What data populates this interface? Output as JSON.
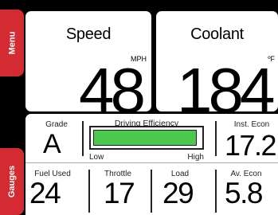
{
  "gauges": {
    "speed": {
      "label": "Speed",
      "unit": "MPH",
      "value": "48"
    },
    "coolant": {
      "label": "Coolant",
      "unit": "ºF",
      "value": "184"
    }
  },
  "tabs": {
    "menu": "Menu",
    "gauges": "Gauges"
  },
  "grade": {
    "label": "Grade",
    "value": "A"
  },
  "efficiency": {
    "label": "Driving Efficiency",
    "low": "Low",
    "high": "High",
    "level": 0.97,
    "color": "#4cc84c"
  },
  "inst_econ": {
    "label": "Inst. Econ",
    "value": "17.2"
  },
  "stats": {
    "fuel_used": {
      "label": "Fuel Used",
      "value": "24"
    },
    "throttle": {
      "label": "Throttle",
      "value": "17"
    },
    "load": {
      "label": "Load",
      "value": "29"
    },
    "av_econ": {
      "label": "Av. Econ",
      "value": "5.8"
    }
  },
  "colors": {
    "tab": "#d42a32",
    "background": "#000000"
  }
}
